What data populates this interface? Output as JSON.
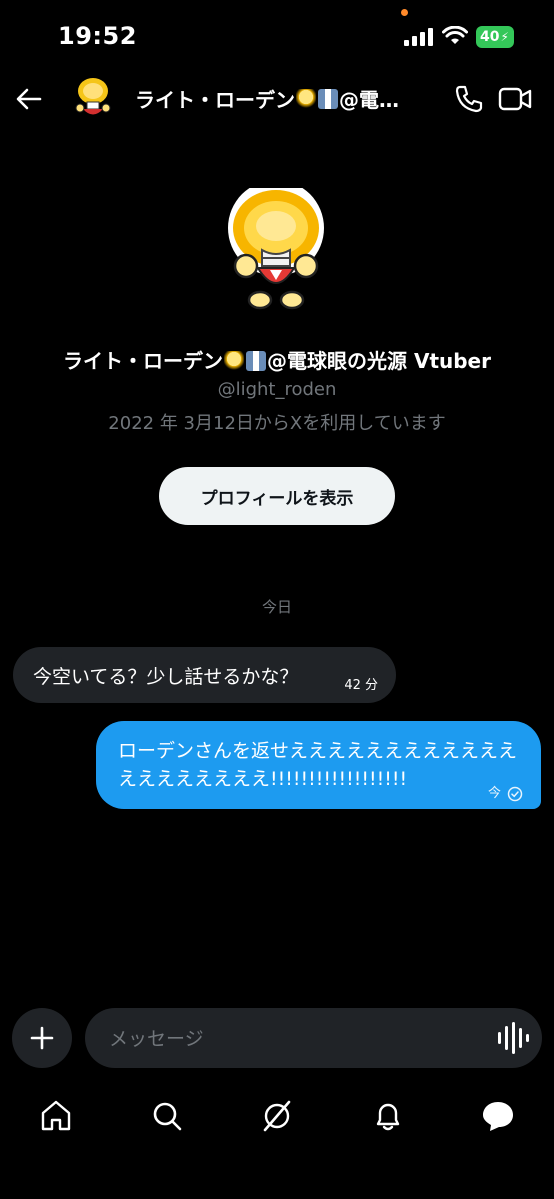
{
  "status_bar": {
    "time": "19:52",
    "battery": "40"
  },
  "header": {
    "name_part1": "ライト・ローデン",
    "name_part2": "@電…"
  },
  "profile": {
    "name_part1": "ライト・ローデン",
    "name_part2": "@電球眼の光源 Vtuber",
    "handle": "@light_roden",
    "joined": "2022 年 3月12日からXを利用しています",
    "view_profile_label": "プロフィールを表示"
  },
  "conversation": {
    "date_separator": "今日",
    "messages": [
      {
        "direction": "incoming",
        "text": "今空いてる？少し話せるかな？",
        "time": "42 分"
      },
      {
        "direction": "outgoing",
        "text": "ローデンさんを返せええええええええええええええええええええ!!!!!!!!!!!!!!!!!!",
        "time": "今",
        "status": "sent"
      }
    ]
  },
  "composer": {
    "placeholder": "メッセージ"
  },
  "nav": {
    "items": [
      "home-icon",
      "search-icon",
      "grok-icon",
      "notifications-icon",
      "messages-icon"
    ]
  },
  "colors": {
    "accent": "#1d9bf0",
    "bubble_in": "#202327",
    "battery": "#34c759",
    "muted": "#71767b"
  }
}
